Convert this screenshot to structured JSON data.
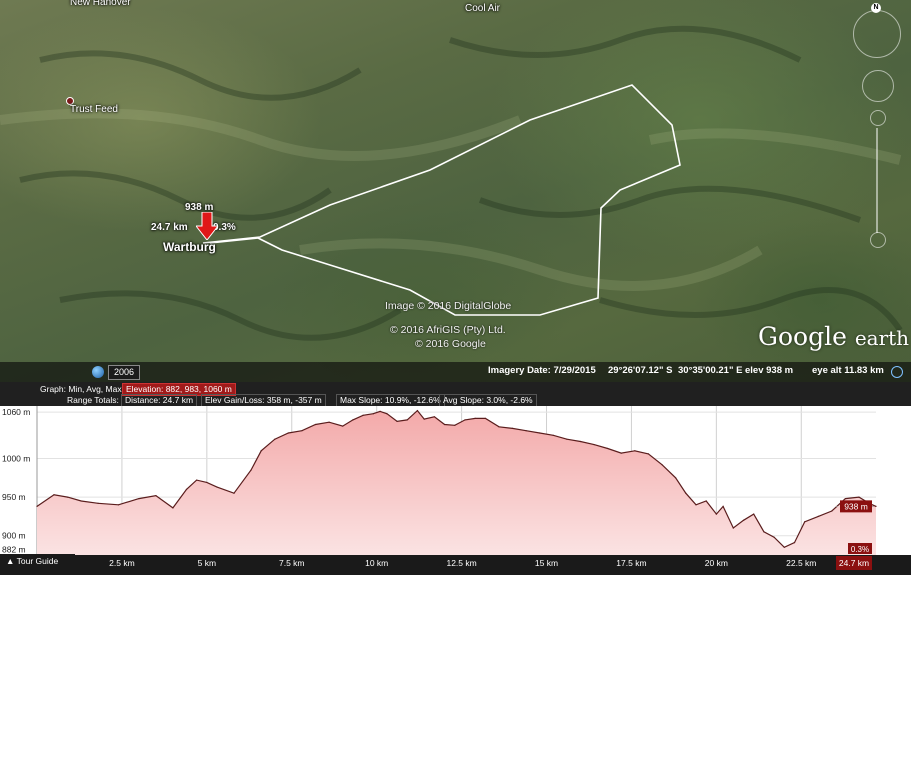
{
  "map": {
    "places": {
      "new_hanover": "New Hanover",
      "cool_air": "Cool Air",
      "trust_feed": "Trust Feed",
      "wartburg": "Wartburg"
    },
    "marker": {
      "elevation": "938 m",
      "distance": "24.7 km",
      "slope": "0.3%"
    },
    "credits": {
      "image": "Image © 2016 DigitalGlobe",
      "afrigis": "© 2016 AfriGIS (Pty) Ltd.",
      "google": "© 2016 Google"
    },
    "logo": {
      "google": "Google",
      "earth": "earth"
    },
    "status": {
      "imagery_date": "Imagery Date: 7/29/2015",
      "lat": "29°26'07.12\" S",
      "lon": "30°35'00.21\" E",
      "elev": "elev   938 m",
      "eye_alt": "eye alt  11.83 km"
    },
    "year": "2006"
  },
  "profile_stats": {
    "graph_label": "Graph: Min, Avg, Max",
    "elevation": "Elevation: 882, 983, 1060 m",
    "range_totals": "Range Totals:",
    "distance": "Distance: 24.7 km",
    "gain_loss": "Elev Gain/Loss: 358 m, -357 m",
    "max_slope": "Max Slope: 10.9%, -12.6%",
    "avg_slope": "Avg Slope: 3.0%, -2.6%",
    "close": "×"
  },
  "tour_guide": "Tour Guide",
  "chart_data": {
    "type": "area",
    "xlabel": "",
    "ylabel": "",
    "xlim": [
      0,
      24.7
    ],
    "ylim": [
      875,
      1068
    ],
    "x_ticks": [
      "2.5 km",
      "5 km",
      "7.5 km",
      "10 km",
      "12.5 km",
      "15 km",
      "17.5 km",
      "20 km",
      "22.5 km"
    ],
    "x_tick_values": [
      2.5,
      5,
      7.5,
      10,
      12.5,
      15,
      17.5,
      20,
      22.5
    ],
    "y_ticks": [
      "1060 m",
      "1000 m",
      "950 m",
      "900 m",
      "882 m"
    ],
    "y_tick_values": [
      1060,
      1000,
      950,
      900,
      882
    ],
    "end_elevation_label": "938 m",
    "end_slope_label": "0.3%",
    "end_distance_label": "24.7 km",
    "colors": {
      "line": "#5a1d1d",
      "fill": "#f7c7c7",
      "fill_top": "#f3a9a9",
      "badge": "#8b1010"
    },
    "series": [
      {
        "x": [
          0,
          0.5,
          0.9,
          1.3,
          1.8,
          2.4,
          3.0,
          3.5,
          4.0,
          4.4,
          4.7,
          5.0,
          5.3,
          5.8,
          6.3,
          6.6,
          7.0,
          7.4,
          7.8,
          8.2,
          8.6,
          9.0,
          9.3,
          9.6,
          9.9,
          10.1,
          10.3,
          10.6,
          10.9,
          11.2,
          11.4,
          11.7,
          12.0,
          12.3,
          12.6,
          12.9,
          13.2,
          13.6,
          14.0,
          14.4,
          14.8,
          15.2,
          15.6,
          16.0,
          16.4,
          16.8,
          17.2,
          17.6,
          18.0,
          18.4,
          18.8,
          19.1,
          19.4,
          19.7,
          20.0,
          20.2,
          20.5,
          20.8,
          21.1,
          21.4,
          21.7,
          22.0,
          22.3,
          22.6,
          23.0,
          23.4,
          23.8,
          24.2,
          24.5,
          24.7
        ],
        "y": [
          938,
          953,
          950,
          945,
          942,
          940,
          948,
          952,
          936,
          960,
          972,
          969,
          963,
          955,
          985,
          1010,
          1025,
          1033,
          1036,
          1044,
          1047,
          1042,
          1050,
          1056,
          1058,
          1061,
          1058,
          1048,
          1050,
          1062,
          1051,
          1054,
          1044,
          1043,
          1050,
          1052,
          1052,
          1041,
          1039,
          1036,
          1033,
          1030,
          1025,
          1022,
          1018,
          1013,
          1007,
          1010,
          1006,
          992,
          975,
          955,
          940,
          945,
          928,
          938,
          910,
          920,
          928,
          905,
          898,
          885,
          891,
          918,
          925,
          932,
          948,
          950,
          942,
          938
        ]
      }
    ]
  }
}
